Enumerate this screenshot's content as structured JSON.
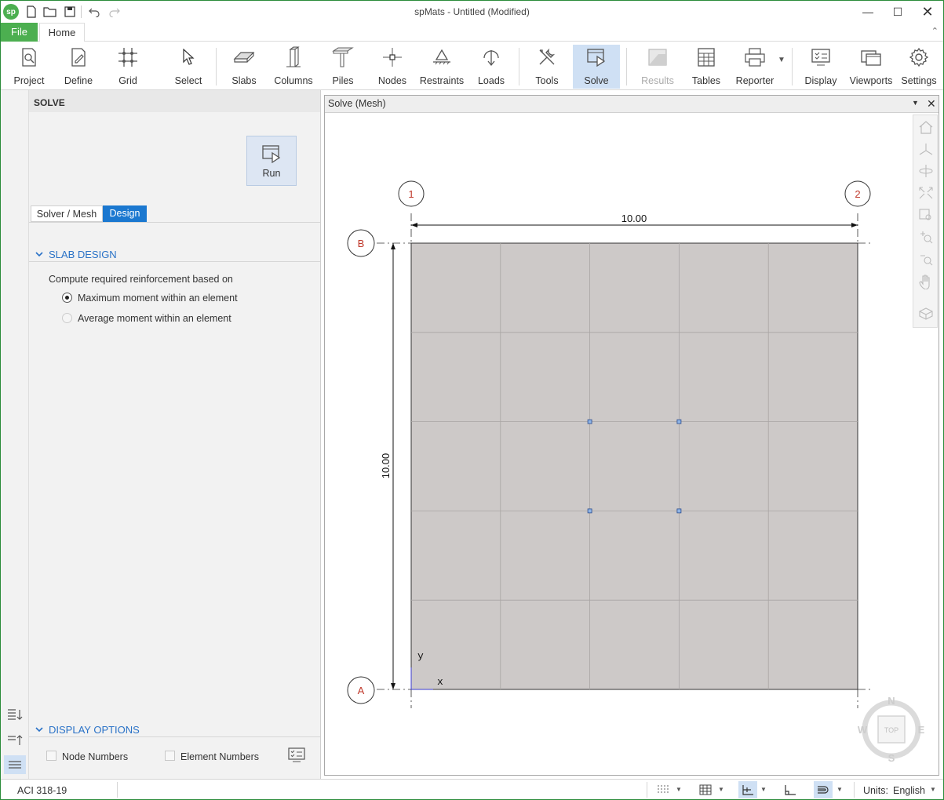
{
  "app": {
    "title": "spMats - Untitled (Modified)",
    "logo_text": "sp",
    "accent": "#4caf50"
  },
  "menu": {
    "file": "File",
    "home": "Home"
  },
  "ribbon": {
    "project": "Project",
    "define": "Define",
    "grid": "Grid",
    "select": "Select",
    "slabs": "Slabs",
    "columns": "Columns",
    "piles": "Piles",
    "nodes": "Nodes",
    "restraints": "Restraints",
    "loads": "Loads",
    "tools": "Tools",
    "solve": "Solve",
    "results": "Results",
    "tables": "Tables",
    "reporter": "Reporter",
    "display": "Display",
    "viewports": "Viewports",
    "settings": "Settings"
  },
  "panel": {
    "title": "SOLVE",
    "run": "Run",
    "tabs": {
      "solver_mesh": "Solver / Mesh",
      "design": "Design"
    },
    "slab_design": {
      "header": "SLAB DESIGN",
      "prompt": "Compute required reinforcement based on",
      "option_max": "Maximum moment within an element",
      "option_avg": "Average moment within an element",
      "selected": "Maximum moment within an element"
    },
    "display_options": {
      "header": "DISPLAY OPTIONS",
      "node_numbers": "Node Numbers",
      "element_numbers": "Element Numbers"
    }
  },
  "viewport": {
    "title": "Solve (Mesh)",
    "grid_labels": {
      "col1": "1",
      "col2": "2",
      "rowA": "A",
      "rowB": "B"
    },
    "dim_horizontal": "10.00",
    "dim_vertical": "10.00",
    "axis_x": "x",
    "axis_y": "y",
    "compass": {
      "n": "N",
      "s": "S",
      "e": "E",
      "w": "W",
      "center": "TOP"
    },
    "mesh_divisions": 5,
    "slab_color": "#cdc9c8",
    "grid_label_color": "#c0392b"
  },
  "status": {
    "code": "ACI 318-19",
    "units_label": "Units:",
    "units_value": "English"
  }
}
